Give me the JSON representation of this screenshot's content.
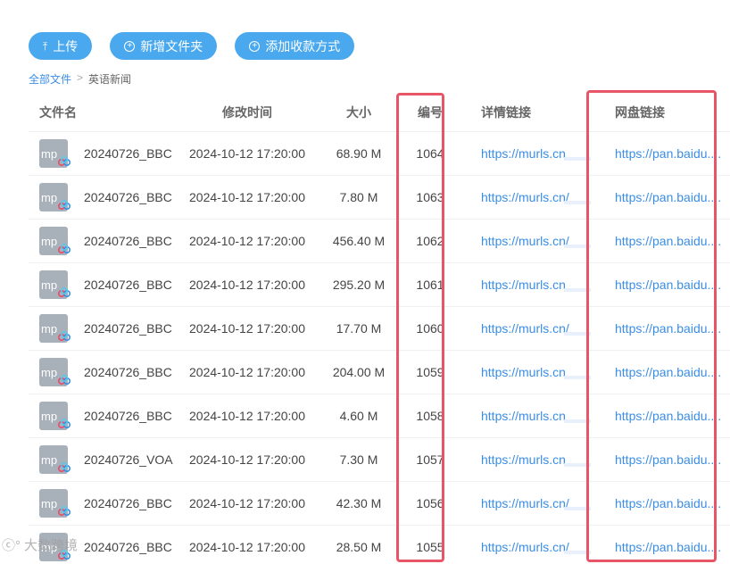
{
  "toolbar": {
    "upload_label": "上传",
    "new_folder_label": "新增文件夹",
    "add_payment_label": "添加收款方式"
  },
  "breadcrumb": {
    "root": "全部文件",
    "separator": ">",
    "current": "英语新闻"
  },
  "table": {
    "headers": {
      "name": "文件名",
      "time": "修改时间",
      "size": "大小",
      "number": "编号",
      "detail": "详情链接",
      "pan": "网盘链接"
    },
    "file_icon_label": "mp",
    "rows": [
      {
        "name": "20240726_BBC",
        "time": "2024-10-12 17:20:00",
        "size": "68.90 M",
        "number": "1064",
        "detail": "https://murls.cn",
        "pan": "https://pan.baidu...."
      },
      {
        "name": "20240726_BBC",
        "time": "2024-10-12 17:20:00",
        "size": "7.80 M",
        "number": "1063",
        "detail": "https://murls.cn/",
        "pan": "https://pan.baidu...."
      },
      {
        "name": "20240726_BBC",
        "time": "2024-10-12 17:20:00",
        "size": "456.40 M",
        "number": "1062",
        "detail": "https://murls.cn/",
        "pan": "https://pan.baidu...."
      },
      {
        "name": "20240726_BBC",
        "time": "2024-10-12 17:20:00",
        "size": "295.20 M",
        "number": "1061",
        "detail": "https://murls.cn",
        "pan": "https://pan.baidu...."
      },
      {
        "name": "20240726_BBC",
        "time": "2024-10-12 17:20:00",
        "size": "17.70 M",
        "number": "1060",
        "detail": "https://murls.cn/",
        "pan": "https://pan.baidu...."
      },
      {
        "name": "20240726_BBC",
        "time": "2024-10-12 17:20:00",
        "size": "204.00 M",
        "number": "1059",
        "detail": "https://murls.cn",
        "pan": "https://pan.baidu...."
      },
      {
        "name": "20240726_BBC",
        "time": "2024-10-12 17:20:00",
        "size": "4.60 M",
        "number": "1058",
        "detail": "https://murls.cn",
        "pan": "https://pan.baidu...."
      },
      {
        "name": "20240726_VOA",
        "time": "2024-10-12 17:20:00",
        "size": "7.30 M",
        "number": "1057",
        "detail": "https://murls.cn",
        "pan": "https://pan.baidu...."
      },
      {
        "name": "20240726_BBC",
        "time": "2024-10-12 17:20:00",
        "size": "42.30 M",
        "number": "1056",
        "detail": "https://murls.cn/",
        "pan": "https://pan.baidu...."
      },
      {
        "name": "20240726_BBC",
        "time": "2024-10-12 17:20:00",
        "size": "28.50 M",
        "number": "1055",
        "detail": "https://murls.cn/",
        "pan": "https://pan.baidu...."
      }
    ]
  },
  "watermark": "大数跨境",
  "colors": {
    "accent": "#49a8ee",
    "link": "#3a8ee6",
    "highlight": "#e85567"
  }
}
